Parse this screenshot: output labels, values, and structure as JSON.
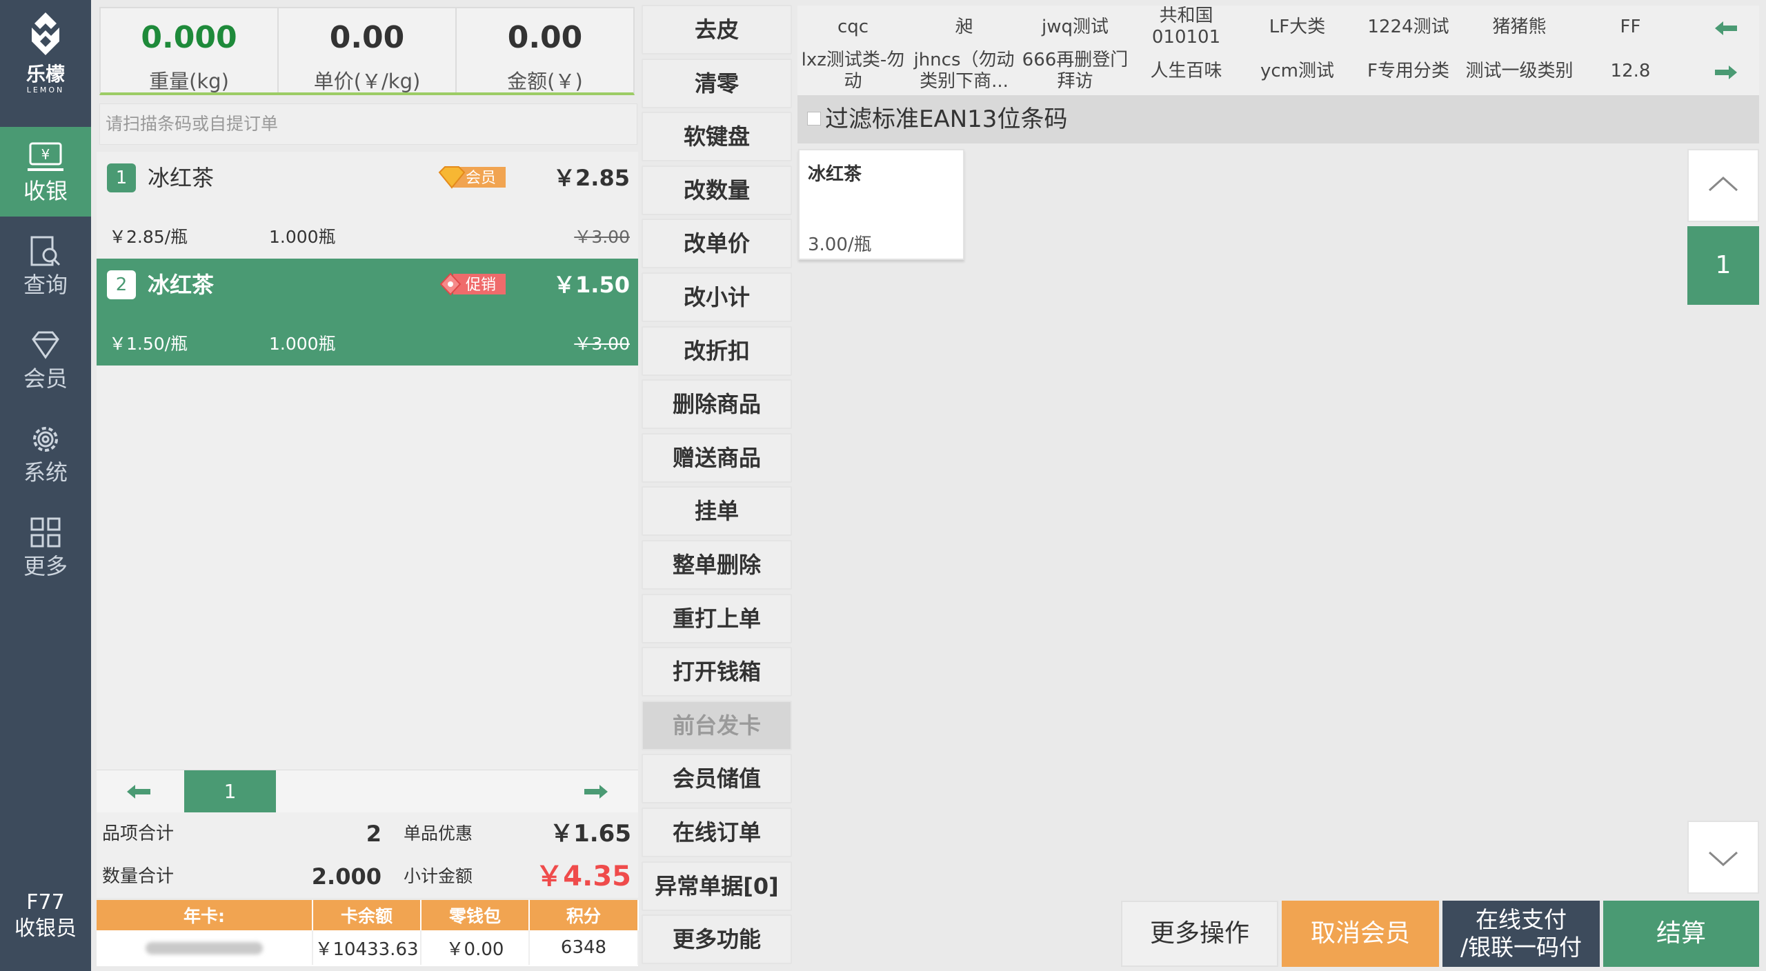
{
  "brand": {
    "name": "乐檬",
    "sub": "LEMON"
  },
  "nav": [
    {
      "label": "收银",
      "icon": "cashier-icon"
    },
    {
      "label": "查询",
      "icon": "query-icon"
    },
    {
      "label": "会员",
      "icon": "member-icon"
    },
    {
      "label": "系统",
      "icon": "settings-icon"
    },
    {
      "label": "更多",
      "icon": "grid-icon"
    }
  ],
  "user": {
    "key": "F77",
    "role": "收银员"
  },
  "scale": {
    "weight": "0.000",
    "weight_label": "重量(kg)",
    "unit_price": "0.00",
    "unit_price_label": "单价(￥/kg)",
    "amount": "0.00",
    "amount_label": "金额(￥)"
  },
  "scan_placeholder": "请扫描条码或自提订单",
  "items": [
    {
      "no": "1",
      "name": "冰红茶",
      "tag": "会员",
      "price": "￥2.85",
      "unit": "￥2.85/瓶",
      "qty": "1.000瓶",
      "orig": "￥3.00"
    },
    {
      "no": "2",
      "name": "冰红茶",
      "tag": "促销",
      "price": "￥1.50",
      "unit": "￥1.50/瓶",
      "qty": "1.000瓶",
      "orig": "￥3.00"
    }
  ],
  "list_page": "1",
  "summary": {
    "items_label": "品项合计",
    "items_count": "2",
    "discount_label": "单品优惠",
    "discount": "￥1.65",
    "qty_label": "数量合计",
    "qty": "2.000",
    "subtotal_label": "小计金额",
    "subtotal": "￥4.35"
  },
  "card": {
    "headers": [
      "年卡:",
      "卡余额",
      "零钱包",
      "积分"
    ],
    "balance": "￥10433.63",
    "wallet": "￥0.00",
    "points": "6348"
  },
  "functions": [
    "去皮",
    "清零",
    "软键盘",
    "改数量",
    "改单价",
    "改小计",
    "改折扣",
    "删除商品",
    "赠送商品",
    "挂单",
    "整单删除",
    "重打上单",
    "打开钱箱",
    "前台发卡",
    "会员储值",
    "在线订单",
    "异常单据[0]",
    "更多功能"
  ],
  "categories_row1": [
    "cqc",
    "昶",
    "jwq测试",
    "共和国010101",
    "LF大类",
    "1224测试",
    "猪猪熊",
    "FF"
  ],
  "categories_row2": [
    "lxz测试类-勿动",
    "jhncs（勿动类别下商...",
    "666再删登门拜访",
    "人生百味",
    "ycm测试",
    "F专用分类",
    "测试一级类别",
    "12.8"
  ],
  "filter_label": "过滤标准EAN13位条码",
  "product": {
    "name": "冰红茶",
    "price": "3.00/瓶"
  },
  "product_page": "1",
  "bottom": {
    "more_ops": "更多操作",
    "cancel_member": "取消会员",
    "online_pay_1": "在线支付",
    "online_pay_2": "/银联一码付",
    "settle": "结算"
  },
  "colors": {
    "nav_bg": "#3d4b5c",
    "accent": "#4a9a73",
    "orange": "#f1a451",
    "red": "#ef4b4b",
    "green_text": "#1e8a3a"
  }
}
